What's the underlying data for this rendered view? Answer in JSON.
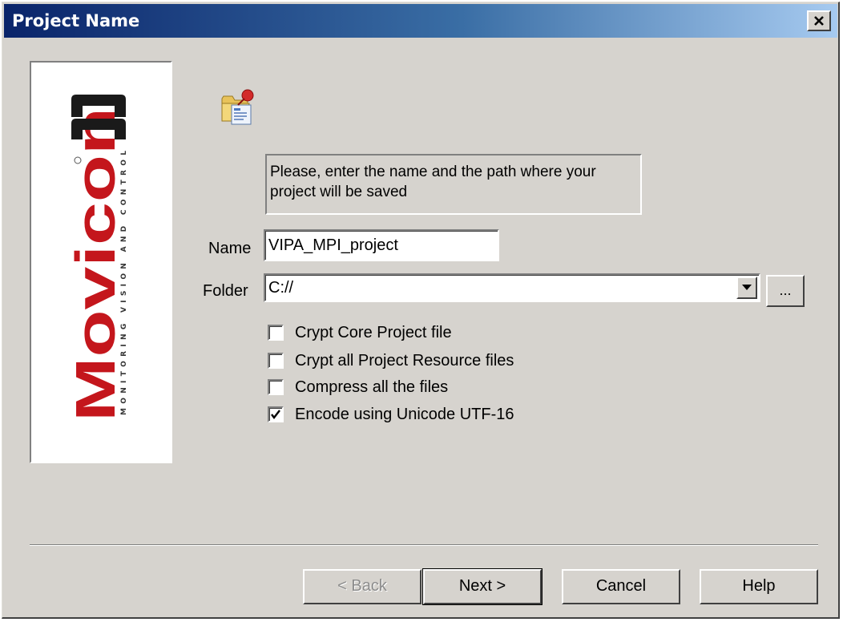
{
  "dialog": {
    "title": "Project Name",
    "close_glyph": "✕"
  },
  "logo": {
    "brand": "Movicon",
    "version_mark": "11",
    "tagline": "MONITORING VISION AND CONTROL",
    "icon": "movicon-logo"
  },
  "header_icon": "folder-project-icon",
  "info_text": "Please, enter the name and the path where your project will be saved",
  "form": {
    "name_label": "Name",
    "name_value": "VIPA_MPI_project",
    "folder_label": "Folder",
    "folder_value": "C://",
    "browse_label": "..."
  },
  "options": [
    {
      "label": "Crypt Core Project file",
      "checked": false
    },
    {
      "label": "Crypt all Project Resource files",
      "checked": false
    },
    {
      "label": "Compress all the files",
      "checked": false
    },
    {
      "label": "Encode using Unicode UTF-16",
      "checked": true
    }
  ],
  "buttons": {
    "back": "< Back",
    "next": "Next >",
    "cancel": "Cancel",
    "help": "Help"
  },
  "colors": {
    "title_gradient_start": "#0a246a",
    "title_gradient_end": "#a6caf0",
    "dialog_bg": "#d6d3ce",
    "logo_red": "#c4161c"
  }
}
